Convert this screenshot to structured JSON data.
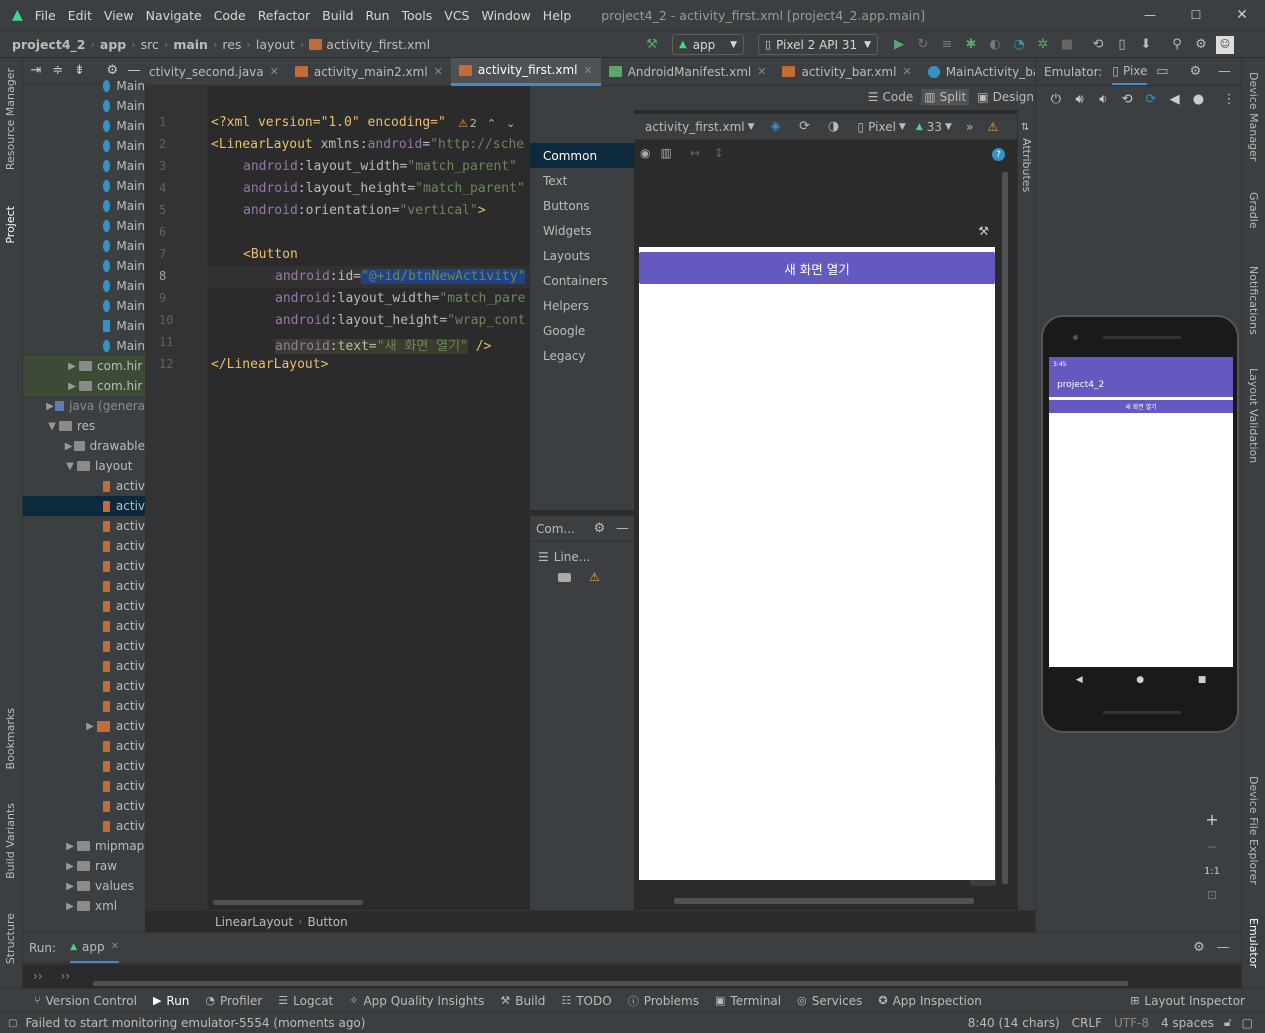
{
  "window": {
    "title": "project4_2 - activity_first.xml [project4_2.app.main]",
    "menu": [
      "File",
      "Edit",
      "View",
      "Navigate",
      "Code",
      "Refactor",
      "Build",
      "Run",
      "Tools",
      "VCS",
      "Window",
      "Help"
    ]
  },
  "breadcrumb": [
    "project4_2",
    "app",
    "src",
    "main",
    "res",
    "layout",
    "activity_first.xml"
  ],
  "toolbar": {
    "run_config": "app",
    "device": "Pixel 2 API 31"
  },
  "tabs": [
    {
      "label": "ctivity_second.java",
      "active": false
    },
    {
      "label": "activity_main2.xml",
      "active": false
    },
    {
      "label": "activity_first.xml",
      "active": true
    },
    {
      "label": "AndroidManifest.xml",
      "active": false
    },
    {
      "label": "activity_bar.xml",
      "active": false
    },
    {
      "label": "MainActivity_bar.ja",
      "active": false
    }
  ],
  "view_modes": {
    "code": "Code",
    "split": "Split",
    "design": "Design"
  },
  "project_tree": {
    "main_items": [
      "Main",
      "Main",
      "Main",
      "Main",
      "Main",
      "Main",
      "Main",
      "Main",
      "Main",
      "Main",
      "Main",
      "Main",
      "Main",
      "Main"
    ],
    "packages": [
      "com.hir",
      "com.hir"
    ],
    "java": "java (genera",
    "res": "res",
    "drawable": "drawable",
    "layout": "layout",
    "layout_files": [
      "activ",
      "activ",
      "activ",
      "activ",
      "activ",
      "activ",
      "activ",
      "activ",
      "activ",
      "activ",
      "activ",
      "activ",
      "activ",
      "activ",
      "activ",
      "activ",
      "activ",
      "activ"
    ],
    "mipmap": "mipmap",
    "raw": "raw",
    "values": "values",
    "xml": "xml"
  },
  "code": {
    "line_numbers": [
      "1",
      "2",
      "3",
      "4",
      "5",
      "6",
      "7",
      "8",
      "9",
      "10",
      "11",
      "12"
    ],
    "l1": {
      "text": "<?xml version=\"1.0\" encoding=\"",
      "warn": "2"
    },
    "l2": {
      "tag": "<LinearLayout",
      "attr": "xmlns:",
      "ns": "android",
      "eq": "=",
      "val": "\"http://sche"
    },
    "l3": {
      "ns": "android",
      "attr": ":layout_width=",
      "val": "\"match_parent\""
    },
    "l4": {
      "ns": "android",
      "attr": ":layout_height=",
      "val": "\"match_parent\""
    },
    "l5": {
      "ns": "android",
      "attr": ":orientation=",
      "val": "\"vertical\"",
      "close": ">"
    },
    "l7": {
      "tag": "<Button"
    },
    "l8": {
      "ns": "android",
      "attr": ":id=",
      "val": "\"@+id/btnNewActivity\""
    },
    "l9": {
      "ns": "android",
      "attr": ":layout_width=",
      "val": "\"match_pare"
    },
    "l10": {
      "ns": "android",
      "attr": ":layout_height=",
      "val": "\"wrap_cont"
    },
    "l11": {
      "ns": "android",
      "attr": ":text=",
      "val": "\"새 화면 열기\"",
      "close": " />"
    },
    "l12": {
      "tag": "</LinearLayout>"
    }
  },
  "editor_breadcrumb": [
    "LinearLayout",
    "Button"
  ],
  "palette": {
    "items": [
      "Common",
      "Text",
      "Buttons",
      "Widgets",
      "Layouts",
      "Containers",
      "Helpers",
      "Google",
      "Legacy"
    ]
  },
  "component_tree": {
    "title": "Com...",
    "item": "Line..."
  },
  "design_toolbar": {
    "file": "activity_first.xml",
    "device": "Pixel",
    "api": "33"
  },
  "design_preview": {
    "button_text": "새 화면 열기"
  },
  "emulator": {
    "label": "Emulator:",
    "tab": "Pixe",
    "app_title": "project4_2",
    "button_text": "새 화면 열기",
    "status_time": "3:45"
  },
  "zoom_label": "1:1",
  "run": {
    "label": "Run:",
    "config": "app"
  },
  "bottom_tools": [
    "Version Control",
    "Run",
    "Profiler",
    "Logcat",
    "App Quality Insights",
    "Build",
    "TODO",
    "Problems",
    "Terminal",
    "Services",
    "App Inspection"
  ],
  "layout_inspector": "Layout Inspector",
  "status": {
    "message": "Failed to start monitoring emulator-5554 (moments ago)",
    "position": "8:40 (14 chars)",
    "line_ending": "CRLF",
    "encoding": "UTF-8",
    "indent": "4 spaces"
  },
  "left_tools": [
    "Resource Manager",
    "Project",
    "Bookmarks",
    "Build Variants",
    "Structure"
  ],
  "right_tools": [
    "Device Manager",
    "Gradle",
    "Notifications",
    "Layout Validation",
    "Device File Explorer",
    "Emulator"
  ],
  "attributes_label": "Attributes",
  "colors": {
    "accent": "#4a88c7",
    "button_purple": "#6359bf",
    "android_green": "#3ddc84"
  }
}
